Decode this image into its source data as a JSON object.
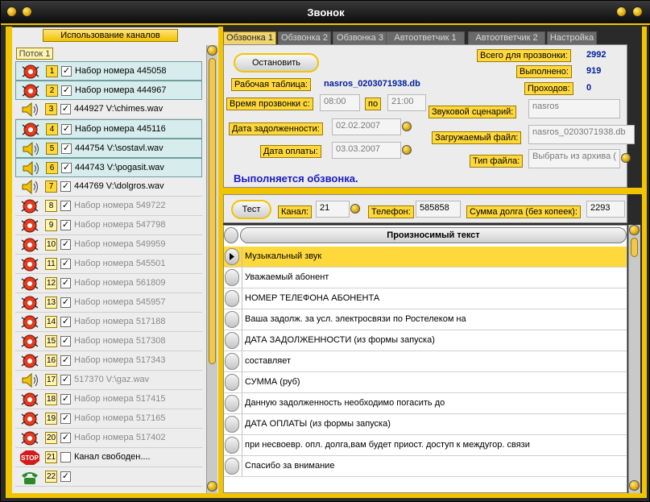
{
  "window": {
    "title": "Звонок"
  },
  "channels": {
    "header": "Использование каналов",
    "thread": "Поток 1",
    "rows": [
      {
        "num": "1",
        "icon": "phone",
        "checked": true,
        "text": "Набор номера 445058",
        "selected": true,
        "active": true,
        "dim": false
      },
      {
        "num": "2",
        "icon": "phone",
        "checked": true,
        "text": "Набор номера 444967",
        "selected": true,
        "active": true,
        "dim": false
      },
      {
        "num": "3",
        "icon": "speaker",
        "checked": true,
        "text": "444927 V:\\chimes.wav",
        "selected": false,
        "active": true,
        "dim": false
      },
      {
        "num": "4",
        "icon": "phone",
        "checked": true,
        "text": "Набор номера 445116",
        "selected": true,
        "active": true,
        "dim": false
      },
      {
        "num": "5",
        "icon": "speaker",
        "checked": true,
        "text": "444754 V:\\sostavl.wav",
        "selected": true,
        "active": true,
        "dim": false
      },
      {
        "num": "6",
        "icon": "speaker",
        "checked": true,
        "text": "444743 V:\\pogasit.wav",
        "selected": true,
        "active": true,
        "dim": false
      },
      {
        "num": "7",
        "icon": "speaker",
        "checked": true,
        "text": "444769 V:\\dolgros.wav",
        "selected": false,
        "active": true,
        "dim": false
      },
      {
        "num": "8",
        "icon": "phone",
        "checked": true,
        "text": "Набор номера 549722",
        "selected": false,
        "active": false,
        "dim": true
      },
      {
        "num": "9",
        "icon": "phone",
        "checked": true,
        "text": "Набор номера 547798",
        "selected": false,
        "active": false,
        "dim": true
      },
      {
        "num": "10",
        "icon": "phone",
        "checked": true,
        "text": "Набор номера 549959",
        "selected": false,
        "active": false,
        "dim": true
      },
      {
        "num": "11",
        "icon": "phone",
        "checked": true,
        "text": "Набор номера 545501",
        "selected": false,
        "active": false,
        "dim": true
      },
      {
        "num": "12",
        "icon": "phone",
        "checked": true,
        "text": "Набор номера 561809",
        "selected": false,
        "active": false,
        "dim": true
      },
      {
        "num": "13",
        "icon": "phone",
        "checked": true,
        "text": "Набор номера 545957",
        "selected": false,
        "active": false,
        "dim": true
      },
      {
        "num": "14",
        "icon": "phone",
        "checked": true,
        "text": "Набор номера 517188",
        "selected": false,
        "active": false,
        "dim": true
      },
      {
        "num": "15",
        "icon": "phone",
        "checked": true,
        "text": "Набор номера 517308",
        "selected": false,
        "active": false,
        "dim": true
      },
      {
        "num": "16",
        "icon": "phone",
        "checked": true,
        "text": "Набор номера 517343",
        "selected": false,
        "active": false,
        "dim": true
      },
      {
        "num": "17",
        "icon": "speaker",
        "checked": true,
        "text": "517370 V:\\gaz.wav",
        "selected": false,
        "active": false,
        "dim": true
      },
      {
        "num": "18",
        "icon": "phone",
        "checked": true,
        "text": "Набор номера 517415",
        "selected": false,
        "active": false,
        "dim": true
      },
      {
        "num": "19",
        "icon": "phone",
        "checked": true,
        "text": "Набор номера 517165",
        "selected": false,
        "active": false,
        "dim": true
      },
      {
        "num": "20",
        "icon": "phone",
        "checked": true,
        "text": "Набор номера 517402",
        "selected": false,
        "active": false,
        "dim": true
      },
      {
        "num": "21",
        "icon": "stop",
        "checked": false,
        "text": "Канал свободен....",
        "selected": false,
        "active": false,
        "dim": false
      },
      {
        "num": "22",
        "icon": "telephone",
        "checked": true,
        "text": "",
        "selected": false,
        "active": false,
        "dim": false
      }
    ]
  },
  "tabs": [
    "Обзвонка 1",
    "Обзвонка 2",
    "Обзвонка 3",
    "Автоответчик 1",
    "Автоответчик 2",
    "Настройка"
  ],
  "call": {
    "stop_button": "Остановить",
    "table_label": "Рабочая таблица:",
    "table_value": "nasros_0203071938.db",
    "total_label": "Всего для прозвонки:",
    "total_value": "2992",
    "done_label": "Выполнено:",
    "done_value": "919",
    "passes_label": "Проходов:",
    "passes_value": "0",
    "time_label": "Время прозвонки с:",
    "time_from": "08:00",
    "time_to_label": "по",
    "time_to": "21:00",
    "debt_date_label": "Дата задолженности:",
    "debt_date": "02.02.2007",
    "pay_date_label": "Дата оплаты:",
    "pay_date": "03.03.2007",
    "scenario_label": "Звуковой сценарий:",
    "scenario_value": "nasros",
    "file_label": "Загружаемый файл:",
    "file_value": "nasros_0203071938.db",
    "filetype_label": "Тип файла:",
    "filetype_value": "Выбрать из архива (",
    "status": "Выполняется обзвонка."
  },
  "test": {
    "test_button": "Тест",
    "channel_label": "Канал:",
    "channel_value": "21",
    "phone_label": "Телефон:",
    "phone_value": "585858",
    "sum_label": "Сумма долга (без копеек):",
    "sum_value": "2293"
  },
  "speech": {
    "header": "Произносимый текст",
    "rows": [
      "Музыкальный звук",
      "Уважаемый абонент",
      "НОМЕР ТЕЛЕФОНА  АБОНЕНТА",
      "Ваша задолж. за усл. электросвязи по Ростелеком на",
      "ДАТА  ЗАДОЛЖЕННОСТИ  (из формы запуска)",
      "составляет",
      "СУММА  (руб)",
      "Данную задолженность необходимо погасить до",
      "ДАТА  ОПЛАТЫ  (из формы запуска)",
      "при несвоевр. опл. долга,вам будет приост. доступ к междугор. связи",
      "Спасибо за внимание"
    ]
  }
}
